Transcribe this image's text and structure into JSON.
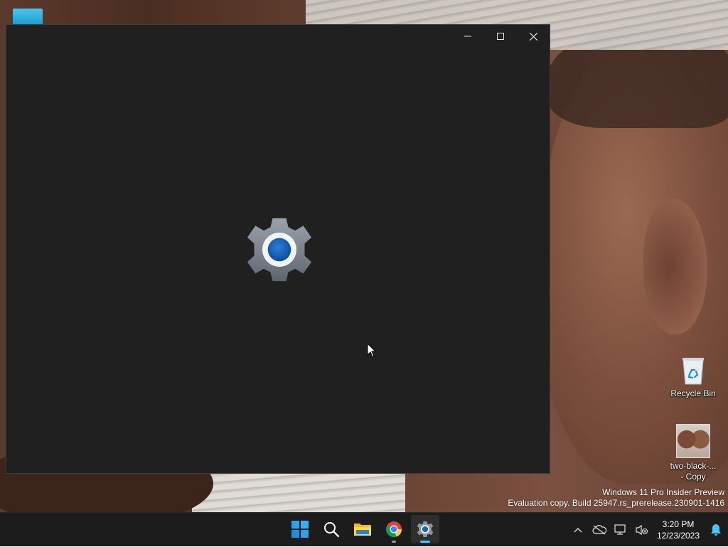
{
  "desktop": {
    "icons": [
      {
        "label": "Recycle Bin"
      },
      {
        "label": "two-black-...\n- Copy"
      }
    ]
  },
  "watermark": {
    "line1": "Windows 11 Pro Insider Preview",
    "line2": "Evaluation copy. Build 25947.rs_prerelease.230901-1416"
  },
  "window": {
    "app": "Settings",
    "state": "loading-splash",
    "controls": {
      "minimize_icon": "minimize-icon",
      "maximize_icon": "maximize-icon",
      "close_icon": "close-icon"
    }
  },
  "taskbar": {
    "apps": [
      {
        "name": "Start",
        "icon": "windows-start-icon"
      },
      {
        "name": "Search",
        "icon": "search-icon"
      },
      {
        "name": "File Explorer",
        "icon": "folder-icon"
      },
      {
        "name": "Google Chrome",
        "icon": "chrome-icon"
      },
      {
        "name": "Settings",
        "icon": "settings-gear-icon",
        "active": true
      }
    ],
    "tray": {
      "time": "3:20 PM",
      "date": "12/23/2023"
    }
  },
  "colors": {
    "window_bg": "#202020",
    "taskbar_bg": "#1c1c1c",
    "accent": "#4cc2ff",
    "gear_blue": "#0f5cb4"
  }
}
